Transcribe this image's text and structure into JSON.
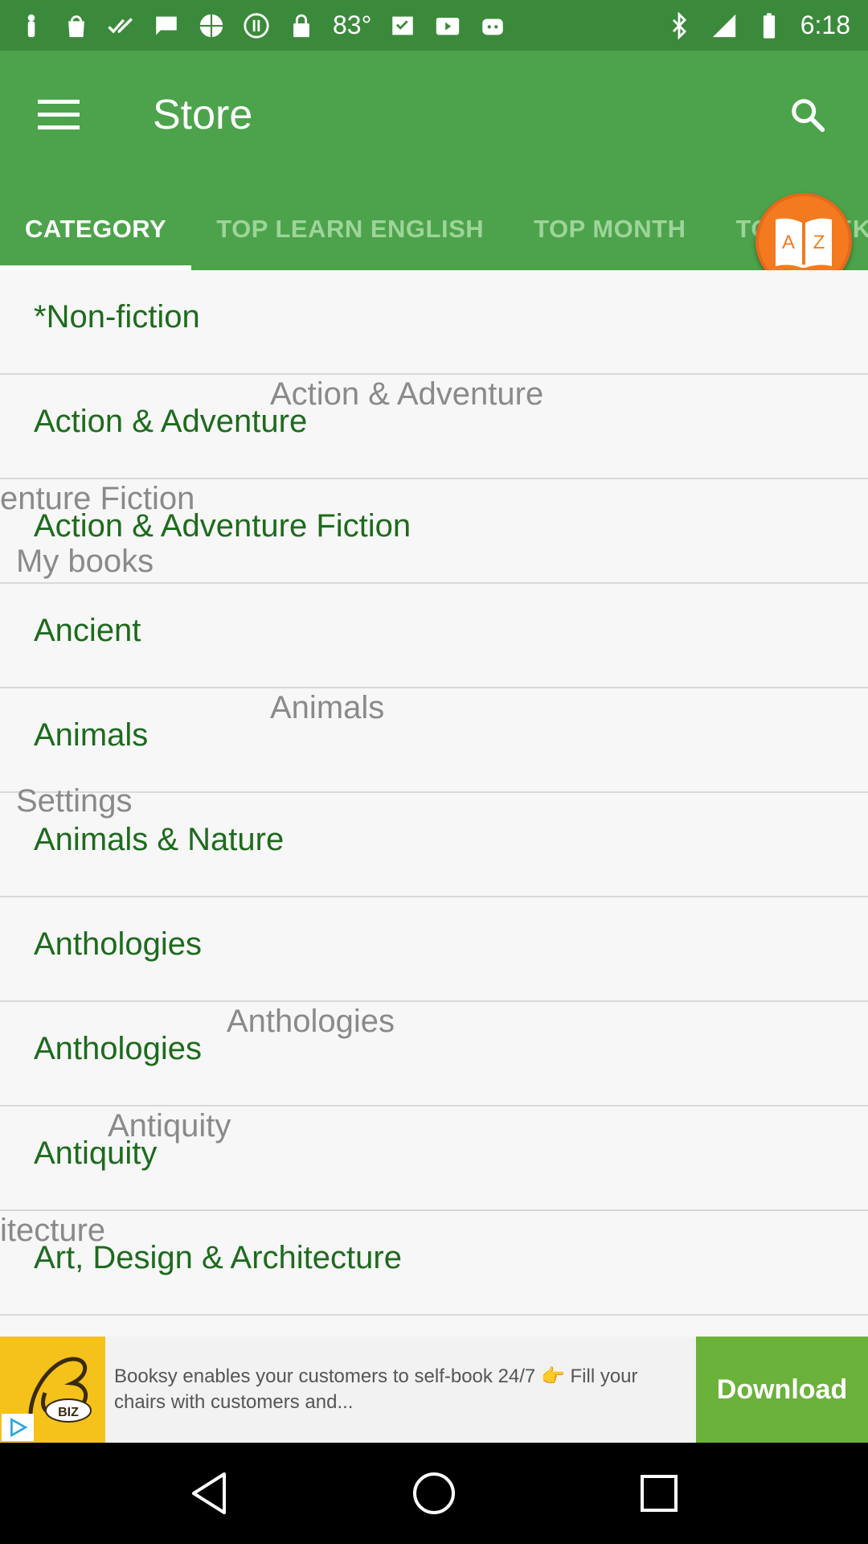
{
  "status_bar": {
    "temperature": "83°",
    "time": "6:18"
  },
  "app_bar": {
    "title": "Store",
    "tabs": [
      {
        "label": "CATEGORY",
        "active": true
      },
      {
        "label": "TOP LEARN ENGLISH",
        "active": false
      },
      {
        "label": "TOP MONTH",
        "active": false
      },
      {
        "label": "TOP WEEK",
        "active": false
      }
    ]
  },
  "fab": {
    "label": "A Z"
  },
  "list": {
    "rows": [
      {
        "label": "*Non-fiction"
      },
      {
        "label": "Action & Adventure"
      },
      {
        "label": "Action & Adventure Fiction"
      },
      {
        "label": "Ancient"
      },
      {
        "label": "Animals"
      },
      {
        "label": "Animals & Nature"
      },
      {
        "label": "Anthologies"
      },
      {
        "label": "Anthologies"
      },
      {
        "label": "Antiquity"
      },
      {
        "label": "Art, Design & Architecture"
      }
    ],
    "overlay_texts": [
      "Action & Adventure",
      "enture Fiction",
      "My books",
      "Animals",
      "Settings",
      "Anthologies",
      "Antiquity",
      "itecture"
    ]
  },
  "ad": {
    "text": "Booksy enables your customers to self-book 24/7 👉 Fill your chairs with customers and...",
    "cta": "Download",
    "badge": "BIZ"
  },
  "colors": {
    "status_bar": "#3b8a3b",
    "primary": "#4ca34b",
    "accent": "#f47a20",
    "list_text": "#1d6b1d",
    "ad_cta": "#6ab23a"
  }
}
